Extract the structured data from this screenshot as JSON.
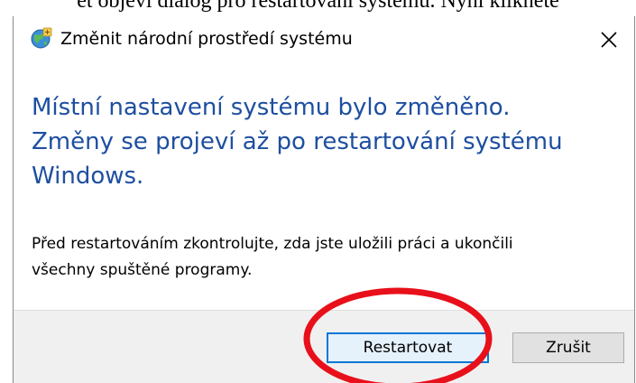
{
  "document": {
    "text_fragment": "et objeví dialog pro restartování systému. Nyní klikněte"
  },
  "dialog": {
    "title": "Změnit národní prostředí systému",
    "icon": "globe-settings-icon",
    "close_label": "×",
    "main_instruction": [
      "Místní nastavení systému bylo změněno.",
      "Změny se projeví až po restartování systému",
      "Windows."
    ],
    "content": [
      "Před restartováním zkontrolujte, zda jste uložili práci a ukončili",
      "všechny spuštěné programy."
    ],
    "buttons": {
      "restart_label": "Restartovat",
      "cancel_label": "Zrušit"
    }
  },
  "colors": {
    "main_instruction": "#1e4fa0",
    "annotation_circle": "#e8101a",
    "default_button_border": "#0078d7",
    "footer_background": "#f0f0f0"
  }
}
